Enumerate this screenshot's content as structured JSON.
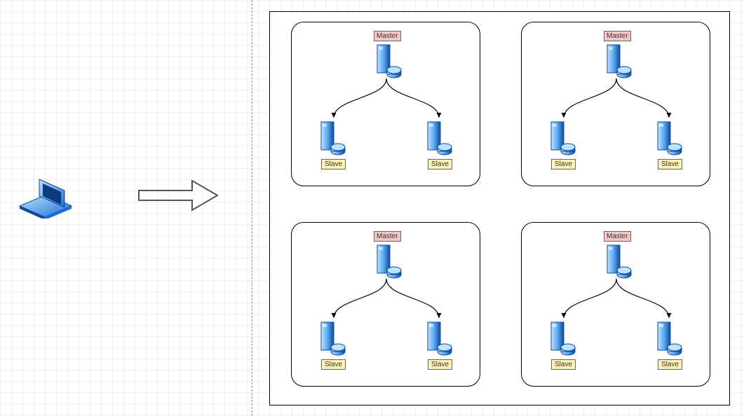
{
  "diagram": {
    "laptop": {
      "name": "client-laptop"
    },
    "arrow": {
      "name": "flow-arrow"
    },
    "clusters": [
      {
        "master_label": "Master",
        "slave_left_label": "Slave",
        "slave_right_label": "Slave"
      },
      {
        "master_label": "Master",
        "slave_left_label": "Slave",
        "slave_right_label": "Slave"
      },
      {
        "master_label": "Master",
        "slave_left_label": "Slave",
        "slave_right_label": "Slave"
      },
      {
        "master_label": "Master",
        "slave_left_label": "Slave",
        "slave_right_label": "Slave"
      }
    ],
    "colors": {
      "master_bg": "#f4c7c7",
      "slave_bg": "#fff2b2",
      "server_blue_light": "#9ecfff",
      "server_blue_dark": "#1a6fd6"
    }
  }
}
